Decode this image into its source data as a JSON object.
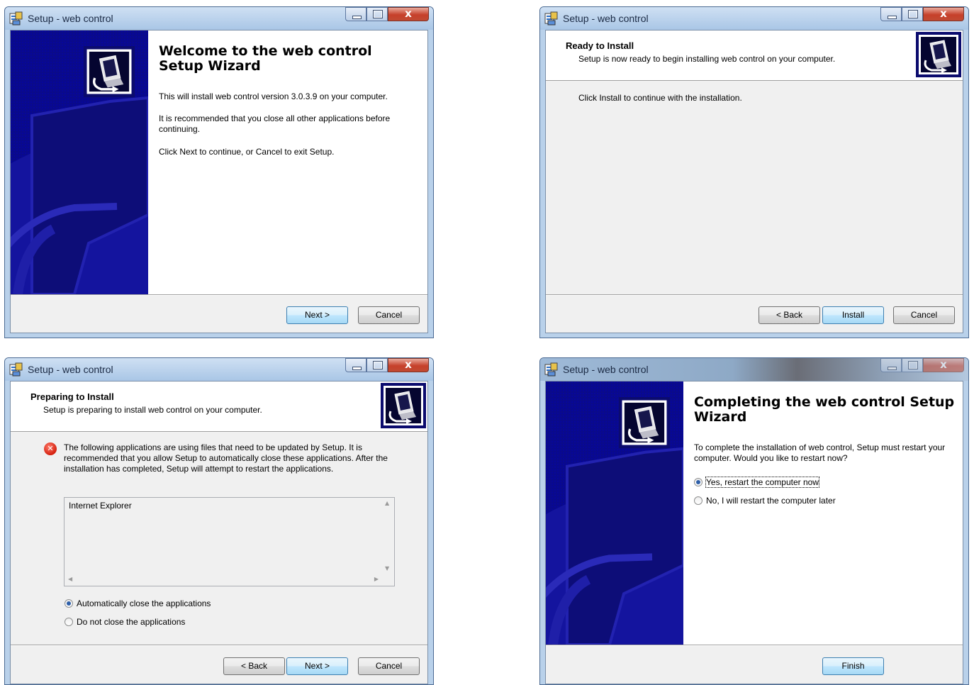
{
  "common": {
    "window_title": "Setup - web control",
    "back_label": "< Back",
    "next_label": "Next >",
    "cancel_label": "Cancel"
  },
  "welcome": {
    "title": "Welcome to the web control Setup Wizard",
    "p1": "This will install web control version 3.0.3.9 on your computer.",
    "p2": "It is recommended that you close all other applications before continuing.",
    "p3": "Click Next to continue, or Cancel to exit Setup."
  },
  "ready": {
    "header_title": "Ready to Install",
    "header_sub": "Setup is now ready to begin installing web control on your computer.",
    "body": "Click Install to continue with the installation.",
    "install_label": "Install"
  },
  "preparing": {
    "header_title": "Preparing to Install",
    "header_sub": "Setup is preparing to install web control on your computer.",
    "message": "The following applications are using files that need to be updated by Setup. It is recommended that you allow Setup to automatically close these applications. After the installation has completed, Setup will attempt to restart the applications.",
    "apps": [
      "Internet Explorer"
    ],
    "option_auto": "Automatically close the applications",
    "option_no": "Do not close the applications"
  },
  "completing": {
    "title": "Completing the web control Setup Wizard",
    "p1": "To complete the installation of web control, Setup must restart your computer. Would you like to restart now?",
    "option_yes": "Yes, restart the computer now",
    "option_no": "No, I will restart the computer later",
    "finish_label": "Finish"
  },
  "colors": {
    "sidebar": "#0b0b8c",
    "titlebar": "#b9d1ea",
    "client": "#f0f0f0",
    "close_button": "#c6402a"
  },
  "icons": [
    "installer-app-icon",
    "computer-install-icon",
    "error-icon"
  ]
}
